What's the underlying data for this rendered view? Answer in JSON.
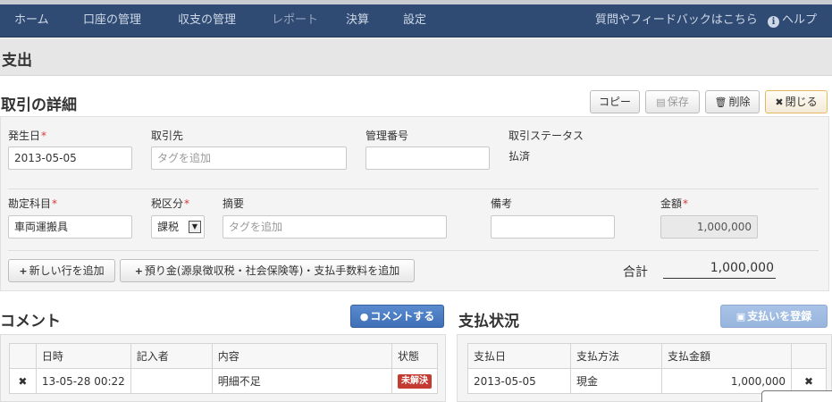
{
  "nav": {
    "items": [
      "ホーム",
      "口座の管理",
      "収支の管理",
      "レポート",
      "決算",
      "設定"
    ],
    "feedback": "質問やフィードバックはこちら",
    "help": "ヘルプ"
  },
  "page": {
    "title": "支出"
  },
  "details": {
    "title": "取引の詳細",
    "buttons": {
      "copy": "コピー",
      "save": "保存",
      "delete": "削除",
      "close": "閉じる"
    },
    "fields": {
      "date_label": "発生日",
      "date_value": "2013-05-05",
      "partner_label": "取引先",
      "partner_placeholder": "タグを追加",
      "mgmt_label": "管理番号",
      "mgmt_value": "",
      "status_label": "取引ステータス",
      "status_value": "払済",
      "account_label": "勘定科目",
      "account_value": "車両運搬具",
      "tax_label": "税区分",
      "tax_value": "課税",
      "summary_label": "摘要",
      "summary_placeholder": "タグを追加",
      "note_label": "備考",
      "note_value": "",
      "amount_label": "金額",
      "amount_value": "1,000,000"
    },
    "add_row": "新しい行を追加",
    "add_withholding": "預り金(源泉徴収税・社会保険等)・支払手数料を追加",
    "total_label": "合計",
    "total_value": "1,000,000"
  },
  "comments": {
    "title": "コメント",
    "button": "コメントする",
    "headers": [
      "",
      "日時",
      "記入者",
      "内容",
      "状態"
    ],
    "rows": [
      {
        "datetime": "13-05-28 00:22",
        "author": "",
        "content": "明細不足",
        "status": "未解決"
      }
    ]
  },
  "payments": {
    "title": "支払状況",
    "button": "支払いを登録",
    "headers": [
      "支払日",
      "支払方法",
      "支払金額",
      ""
    ],
    "rows": [
      {
        "date": "2013-05-05",
        "method": "現金",
        "amount": "1,000,000"
      }
    ]
  }
}
